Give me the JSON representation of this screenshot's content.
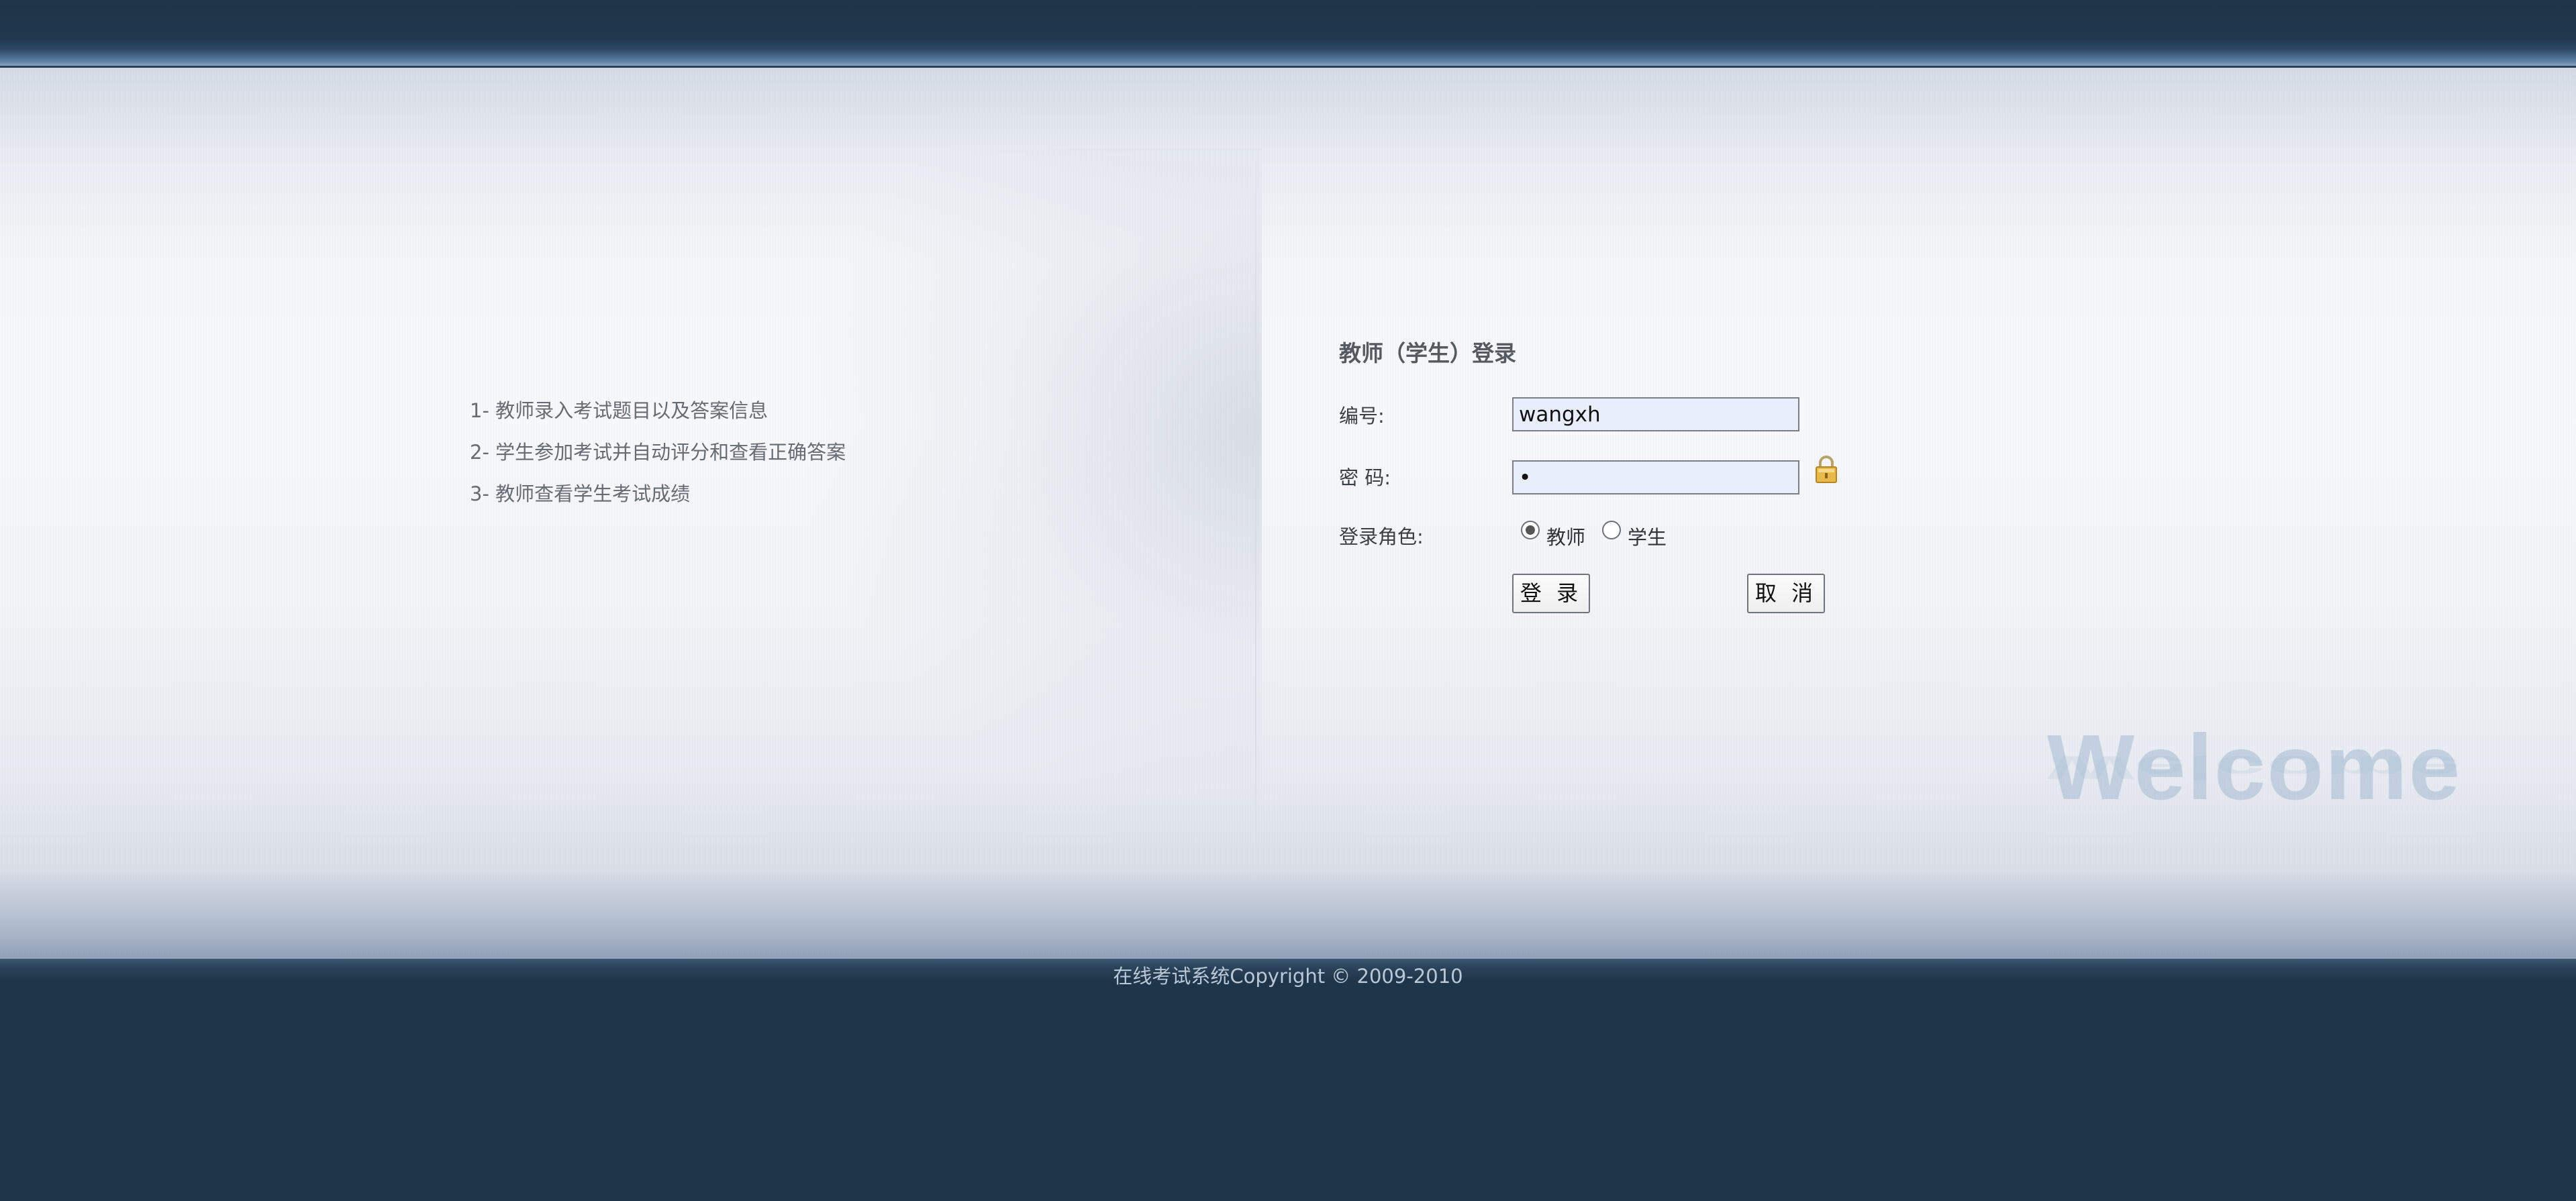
{
  "features": [
    "1- 教师录入考试题目以及答案信息",
    "2- 学生参加考试并自动评分和查看正确答案",
    "3- 教师查看学生考试成绩"
  ],
  "login": {
    "title": "教师（学生）登录",
    "id_label": "编号:",
    "id_value": "wangxh",
    "password_label": "密 码:",
    "password_value": "•",
    "role_label": "登录角色:",
    "roles": [
      {
        "label": "教师",
        "checked": true
      },
      {
        "label": "学生",
        "checked": false
      }
    ],
    "login_button": "登 录",
    "cancel_button": "取 消"
  },
  "welcome_text": "Welcome",
  "footer": {
    "copyright": "在线考试系统Copyright © 2009-2010"
  },
  "colors": {
    "header_bg": "#1f3449",
    "footer_bg": "#1f3549",
    "input_bg": "#e8eefb",
    "watermark": "#a5bcd2"
  },
  "icons": {
    "password_lock": "lock-icon"
  }
}
